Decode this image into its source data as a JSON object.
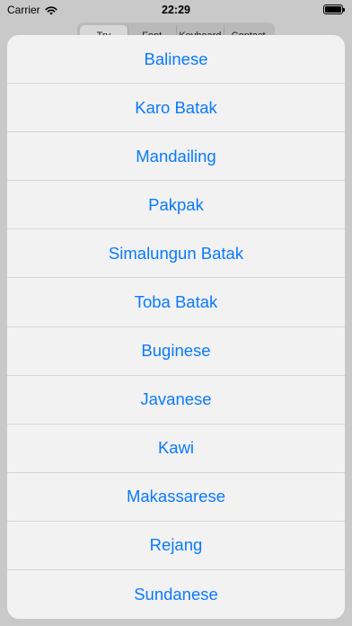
{
  "status_bar": {
    "carrier": "Carrier",
    "time": "22:29",
    "wifi_icon": "wifi-icon",
    "battery_icon": "battery-full-icon"
  },
  "segmented_control": {
    "segments": [
      "Try",
      "Font",
      "Keyboard",
      "Contact"
    ],
    "selected_index": 0
  },
  "action_sheet": {
    "accent_color": "#0a7aff",
    "options": [
      "Balinese",
      "Karo Batak",
      "Mandailing",
      "Pakpak",
      "Simalungun Batak",
      "Toba Batak",
      "Buginese",
      "Javanese",
      "Kawi",
      "Makassarese",
      "Rejang",
      "Sundanese"
    ]
  }
}
